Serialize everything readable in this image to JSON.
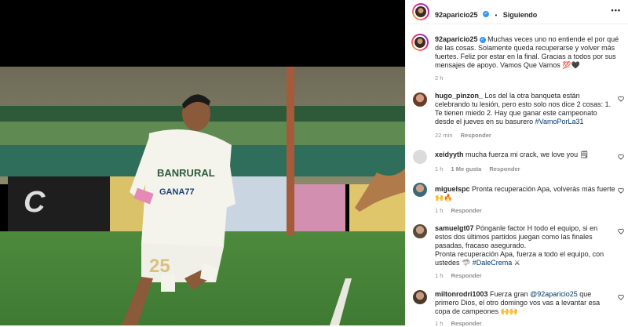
{
  "header": {
    "username": "92aparicio25",
    "separator": "•",
    "follow_status": "Siguiendo",
    "more": "•••"
  },
  "caption": {
    "username": "92aparicio25",
    "text": "Muchas veces uno no entiende el por qué de las cosas. Solamente queda recuperarse y volver más fuertes. Feliz por estar en la final. Gracias a todos por sus mensajes de apoyo. Vamos Que Vamos 💯🖤",
    "time": "2 h"
  },
  "photo": {
    "jersey_text_1": "BANRURAL",
    "jersey_text_2": "GANA77",
    "jersey_number": "25"
  },
  "comments": [
    {
      "username": "hugo_pinzon_",
      "text": "Los del la otra banqueta están celebrando tu lesión, pero esto solo nos dice 2 cosas: 1. Te tienen miedo 2. Hay que ganar este campeonato desde el jueves en su basurero",
      "hashtag": "#VamoPorLa31",
      "time": "22 min",
      "reply": "Responder"
    },
    {
      "username": "xeidyyth",
      "text": "mucha fuerza mi crack, we love you 🗒",
      "time": "1 h",
      "likes": "1 Me gusta",
      "reply": "Responder"
    },
    {
      "username": "miguelspc",
      "text": "Pronta recuperación Apa, volverás más fuerte 🙌🔥",
      "time": "1 h",
      "reply": "Responder"
    },
    {
      "username": "samuelgt07",
      "text": "Pónganle factor H todo el equipo, si en estos dos últimos partidos juegan como las finales pasadas, fracaso asegurado.",
      "text2": "Pronta recuperación Apa, fuerza a todo el equipo, con ustedes 🦈",
      "hashtag": "#DaleCrema",
      "tail": "⚔",
      "time": "1 h",
      "reply": "Responder"
    },
    {
      "username": "miltonrodri1003",
      "text_pre": "Fuerza gran",
      "mention": "@92aparicio25",
      "text_post": "que primero Dios, el otro domingo vos vas a levantar esa copa de campeones 🙌🙌",
      "time": "1 h",
      "reply": "Responder"
    }
  ],
  "icons": [
    "verified-badge",
    "heart-icon",
    "more-icon"
  ],
  "colors": {
    "link": "#00376b",
    "meta": "#8e8e8e",
    "verified": "#3897f0",
    "border": "#efefef"
  }
}
